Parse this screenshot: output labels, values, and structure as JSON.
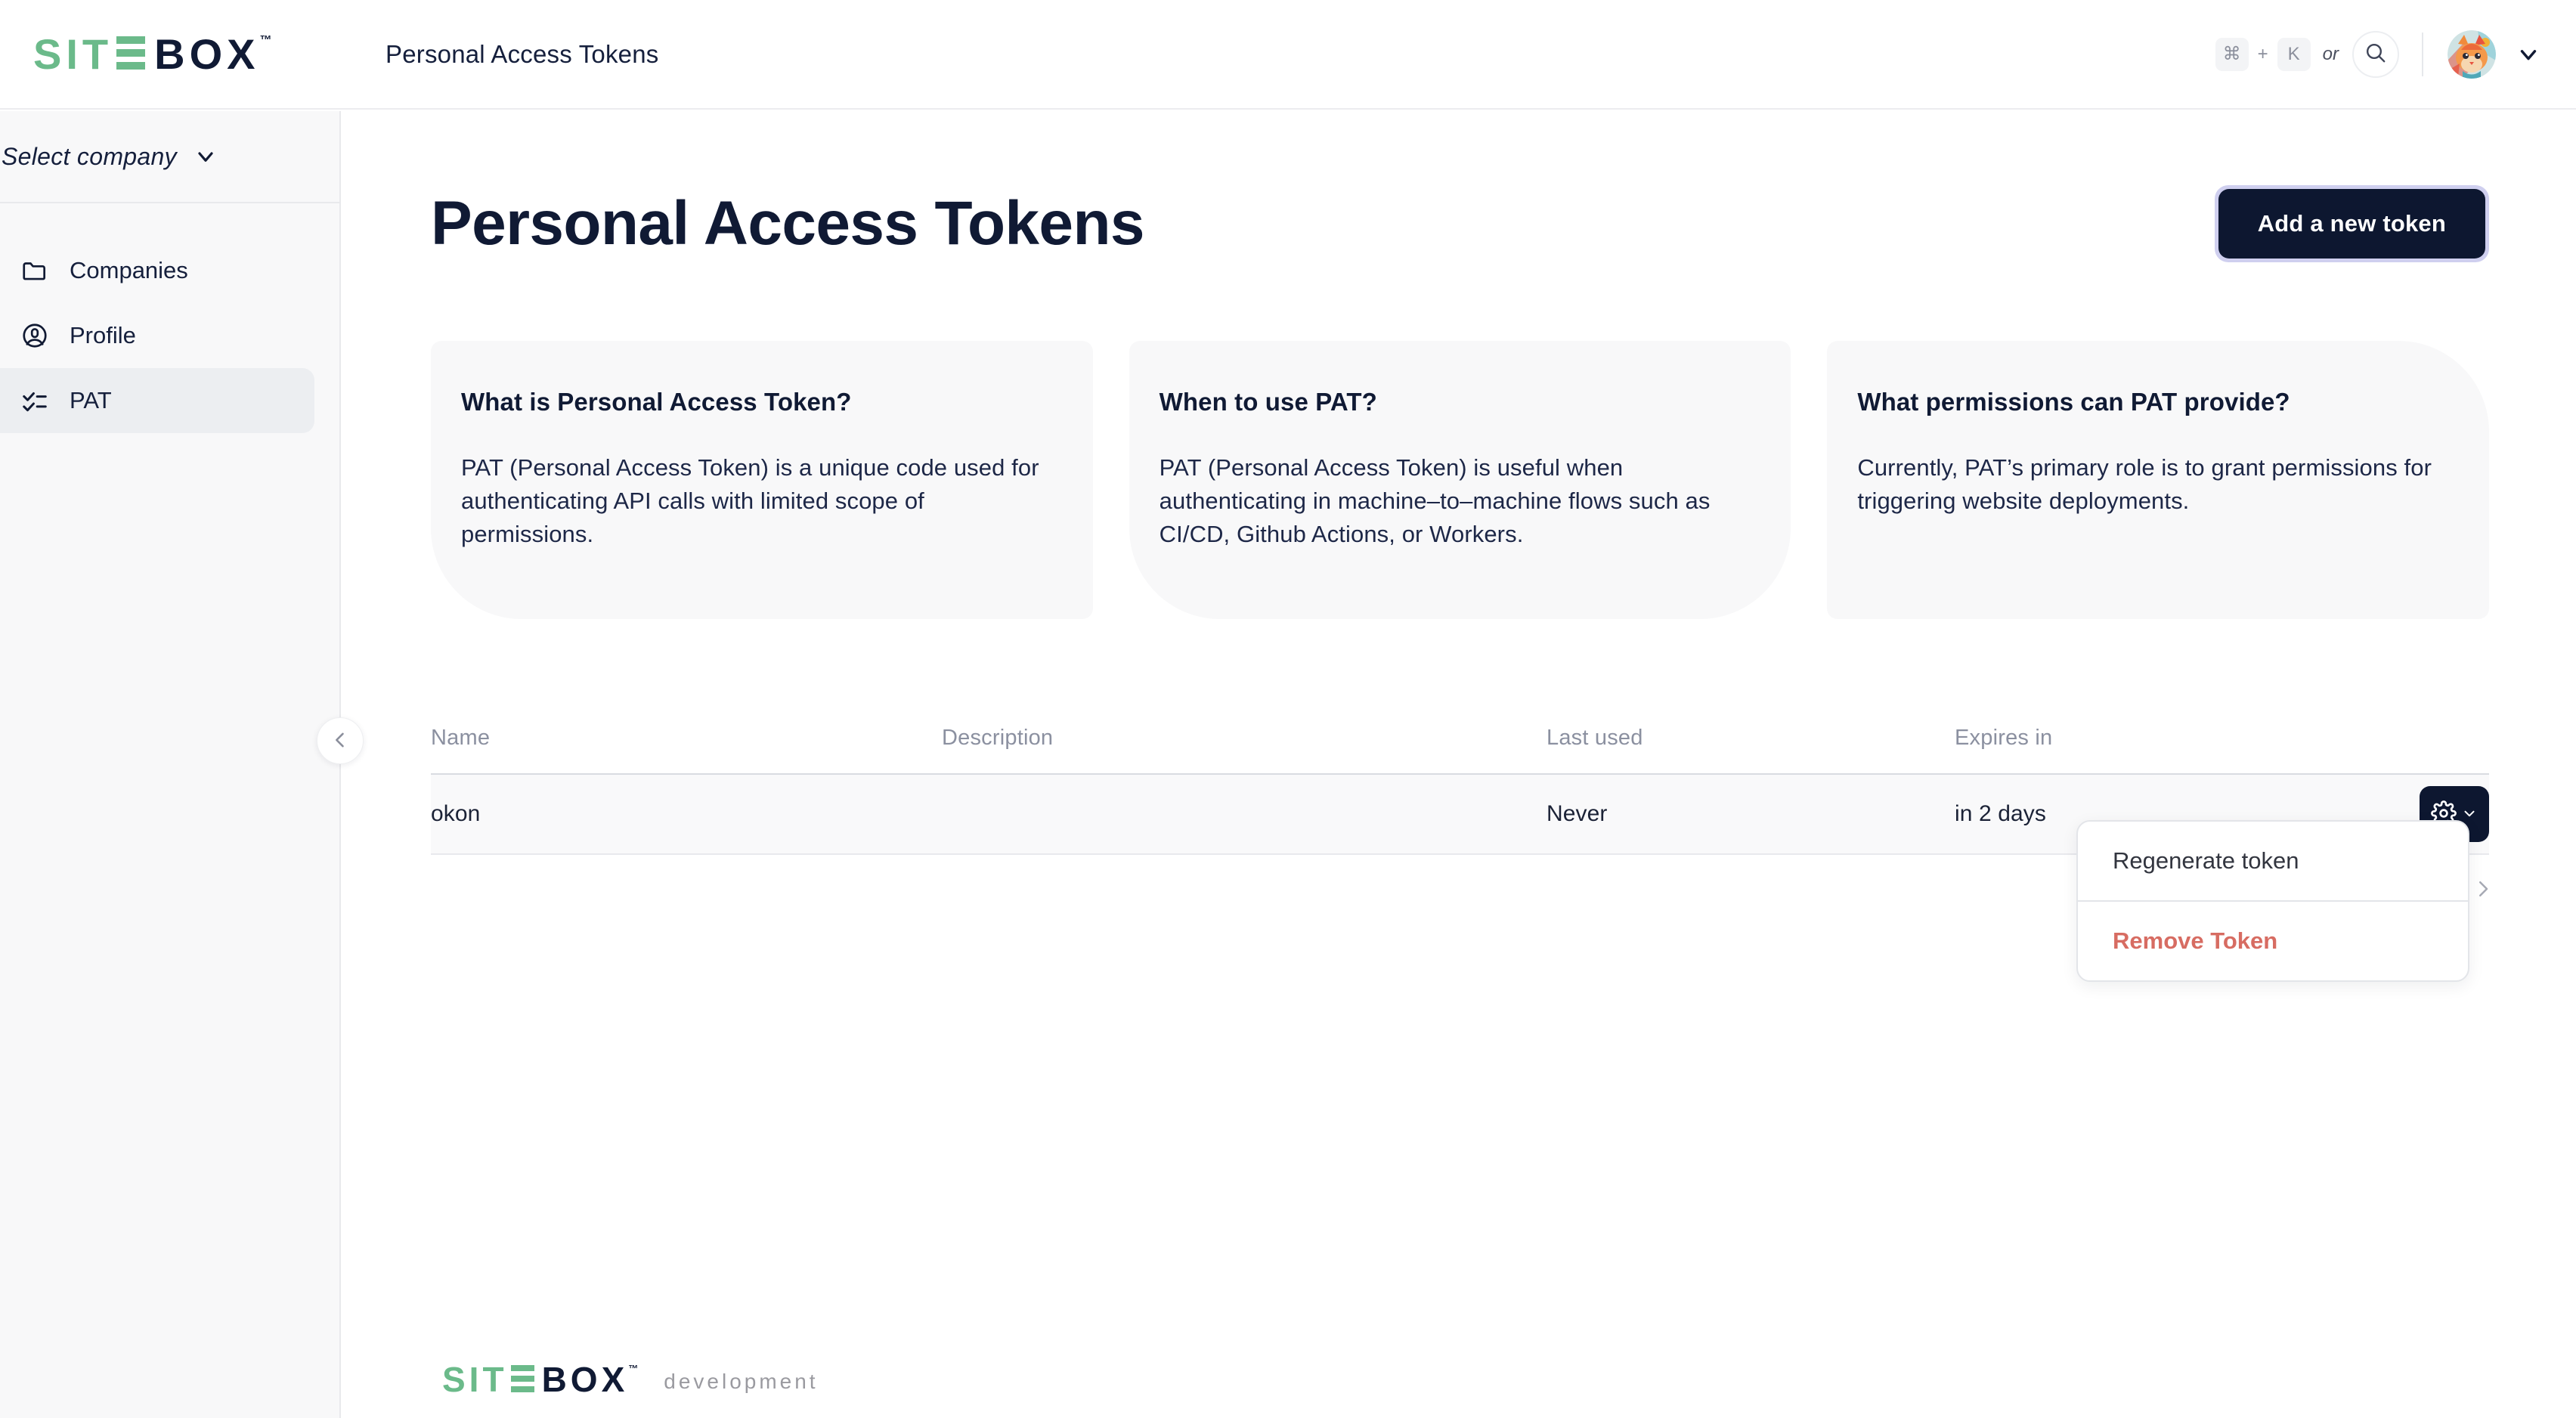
{
  "brand": {
    "logo_green_part": "SIT",
    "logo_dark_part": "BOX",
    "trademark": "™",
    "green": "#6bba8a",
    "navy": "#101a34"
  },
  "topbar": {
    "title": "Personal Access Tokens",
    "shortcut_modifier": "⌘",
    "shortcut_plus": "+",
    "shortcut_key": "K",
    "or_label": "or",
    "search_icon": "search-icon",
    "avatar_icon": "user-avatar-cat",
    "account_caret_icon": "chevron-down-icon"
  },
  "sidebar": {
    "company_selector_label": "Select company",
    "company_selector_icon": "chevron-down-icon",
    "collapse_icon": "chevron-left-icon",
    "items": [
      {
        "label": "Companies",
        "icon": "folder-icon",
        "active": false
      },
      {
        "label": "Profile",
        "icon": "user-circle-icon",
        "active": false
      },
      {
        "label": "PAT",
        "icon": "checklist-icon",
        "active": true
      }
    ]
  },
  "main": {
    "page_title": "Personal Access Tokens",
    "add_button_label": "Add a new token",
    "add_button_color": "#0d1730",
    "cards": [
      {
        "heading": "What is Personal Access Token?",
        "body": "PAT (Personal Access Token) is a unique code used for authenticating API calls with limited scope of permissions."
      },
      {
        "heading": "When to use PAT?",
        "body": "PAT (Personal Access Token) is useful when authenticating in machine–to–machine flows such as CI/CD, Github Actions, or Workers."
      },
      {
        "heading": "What permissions can PAT provide?",
        "body": "Currently, PAT’s primary role is to grant permissions for triggering website deployments."
      }
    ],
    "table": {
      "columns": [
        "Name",
        "Description",
        "Last used",
        "Expires in"
      ],
      "rows": [
        {
          "name": "okon",
          "description": "",
          "last_used": "Never",
          "expires_in": "in 2 days"
        }
      ],
      "row_action_icon": "gear-icon",
      "row_action_caret_icon": "chevron-down-icon",
      "next_page_icon": "chevron-right-icon"
    },
    "dropdown": {
      "open": true,
      "items": [
        {
          "label": "Regenerate token",
          "danger": false
        },
        {
          "label": "Remove Token",
          "danger": true
        }
      ],
      "danger_color": "#d76c62"
    }
  },
  "footer": {
    "environment_label": "development"
  }
}
